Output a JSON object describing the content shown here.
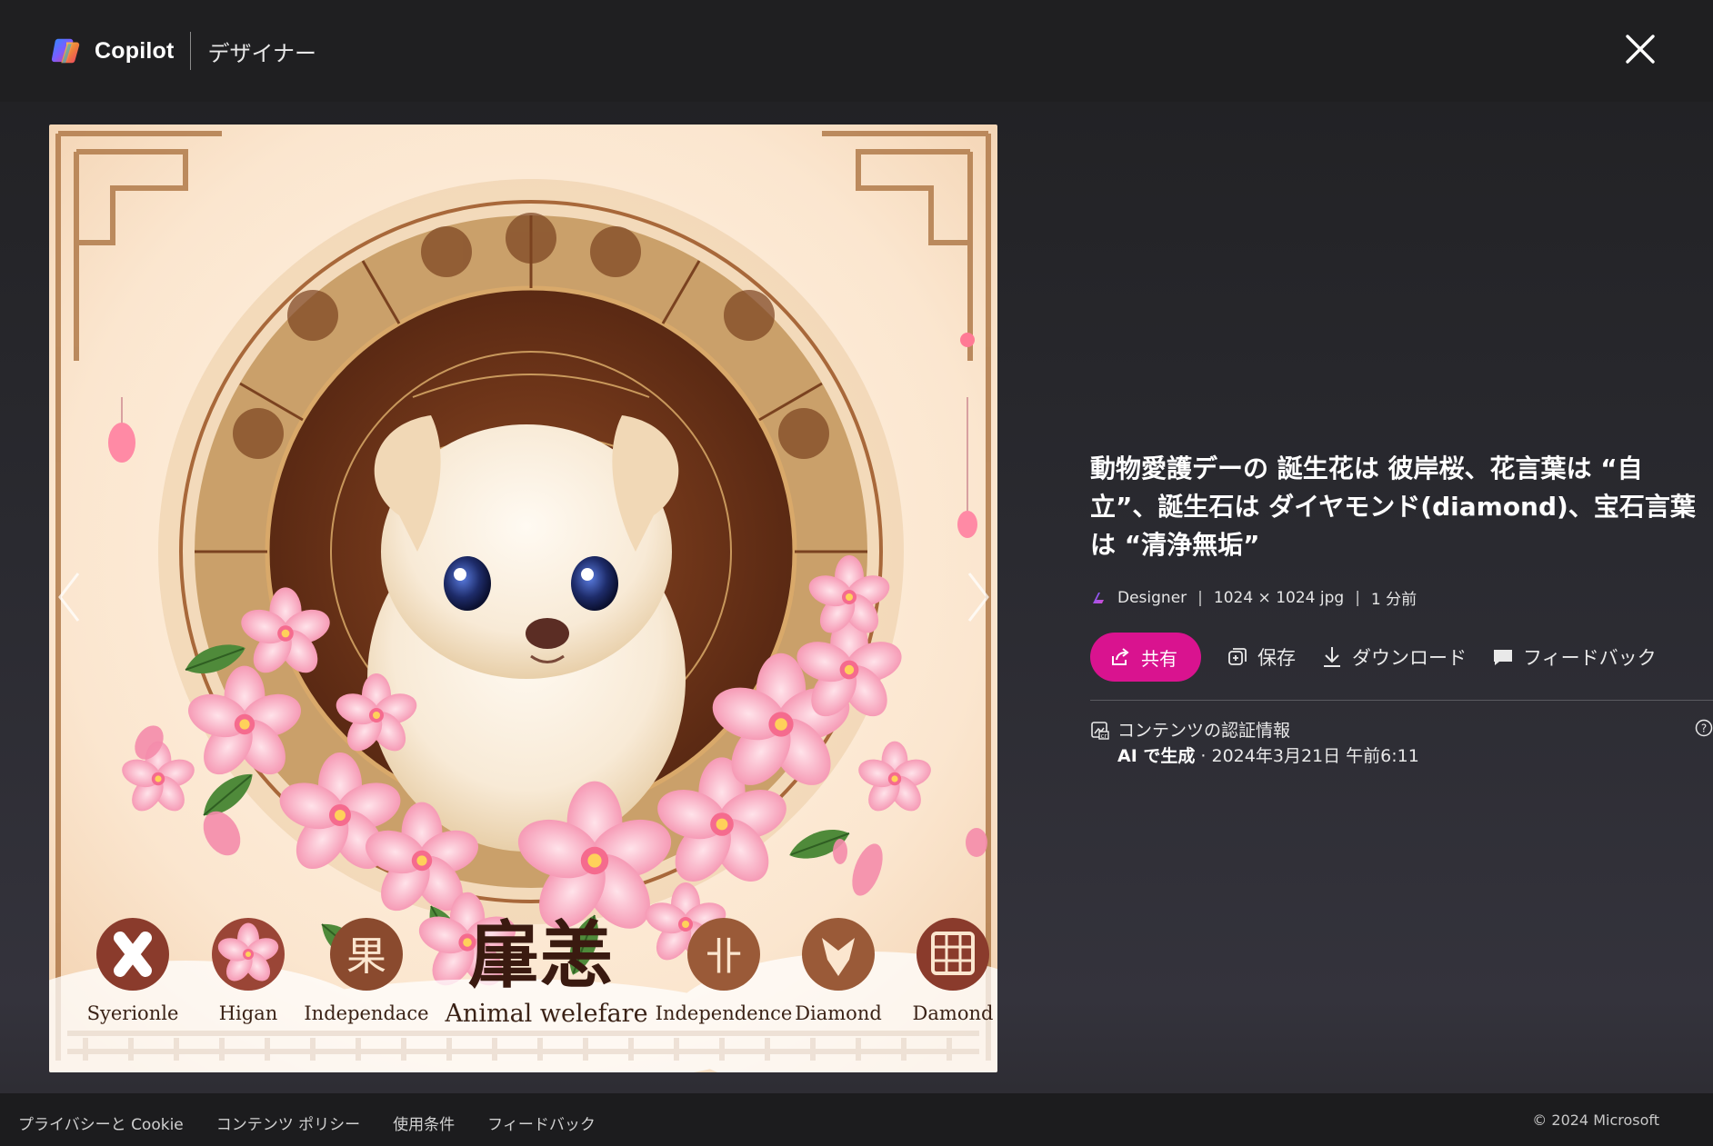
{
  "header": {
    "brand": "Copilot",
    "product": "デザイナー",
    "close_icon": "close-icon"
  },
  "image": {
    "alt": "",
    "bottom_captions": [
      "Syerionle",
      "Higan",
      "Independace",
      "Animal welefare",
      "Independence",
      "Diamond",
      "Damond"
    ],
    "headline_glyphs": "肁恙",
    "prev_icon": "chevron-left-icon",
    "next_icon": "chevron-right-icon"
  },
  "details": {
    "title": "動物愛護デーの 誕生花は 彼岸桜、花言葉は “自立”、誕生石は ダイヤモンド(diamond)、宝石言葉は “清浄無垢”",
    "meta": {
      "creator": "Designer",
      "size": "1024 × 1024 jpg",
      "time": "1 分前"
    },
    "actions": {
      "share": "共有",
      "save": "保存",
      "download": "ダウンロード",
      "feedback": "フィードバック"
    },
    "credentials": {
      "title": "コンテンツの認証情報",
      "ai_label": "AI で生成",
      "date": " · 2024年3月21日 午前6:11"
    }
  },
  "footer": {
    "links": [
      "プライバシーと Cookie",
      "コンテンツ ポリシー",
      "使用条件",
      "フィードバック"
    ],
    "copyright": "© 2024 Microsoft"
  },
  "colors": {
    "accent": "#d9138f",
    "background": "#1f1f21"
  }
}
